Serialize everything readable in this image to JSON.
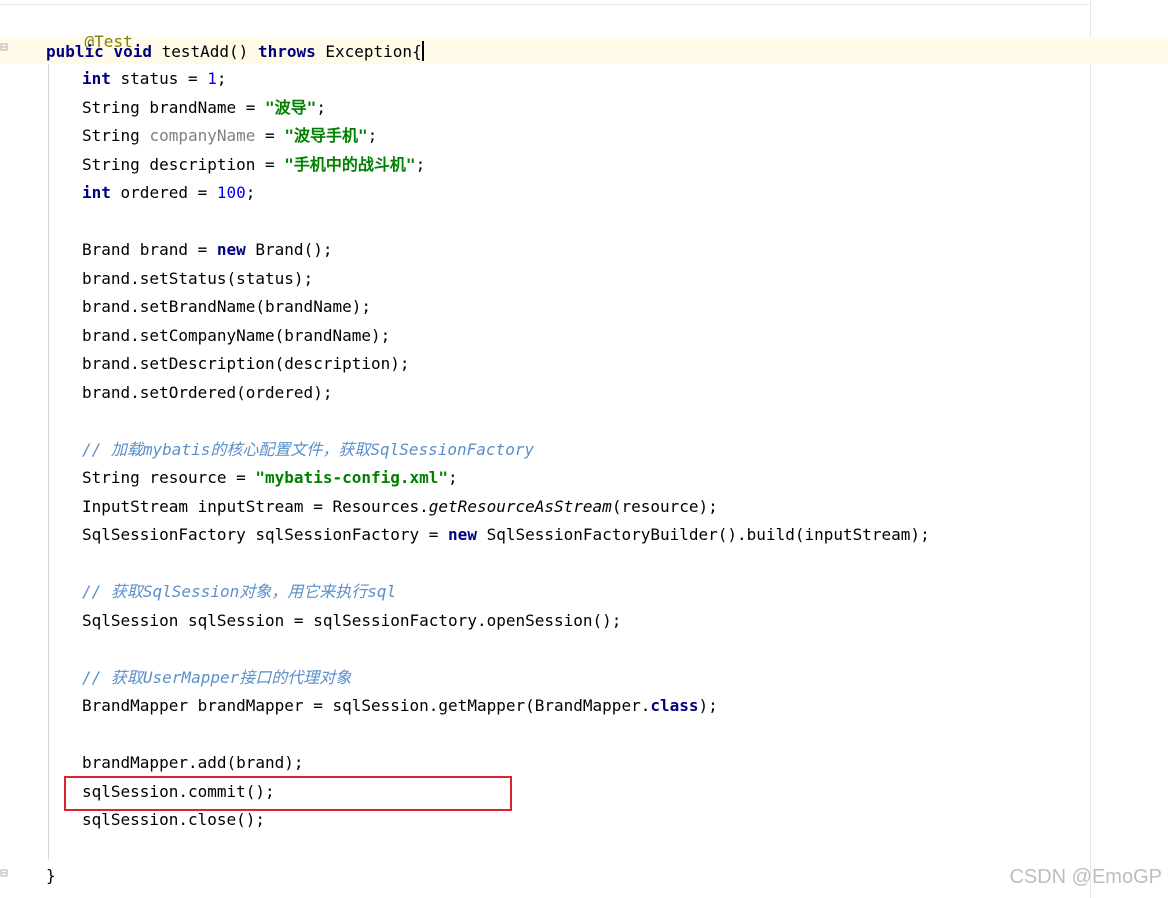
{
  "editor": {
    "lines": {
      "l01": {
        "annotation": "@Test"
      },
      "l02": {
        "kw1": "public",
        "kw2": "void",
        "name": "testAdd() ",
        "kw3": "throws",
        "rest": " Exception{"
      },
      "l03": {
        "kw": "int",
        "a": " status = ",
        "num": "1",
        "b": ";"
      },
      "l04": {
        "a": "String brandName = ",
        "str": "\"波导\"",
        "b": ";"
      },
      "l05": {
        "a": "String ",
        "unused": "companyName",
        "b": " = ",
        "str": "\"波导手机\"",
        "c": ";"
      },
      "l06": {
        "a": "String description = ",
        "str": "\"手机中的战斗机\"",
        "b": ";"
      },
      "l07": {
        "kw": "int",
        "a": " ordered = ",
        "num": "100",
        "b": ";"
      },
      "l08": {
        "a": "Brand brand = ",
        "kw": "new",
        "b": " Brand();"
      },
      "l09": {
        "text": "brand.setStatus(status);"
      },
      "l10": {
        "text": "brand.setBrandName(brandName);"
      },
      "l11": {
        "text": "brand.setCompanyName(brandName);"
      },
      "l12": {
        "text": "brand.setDescription(description);"
      },
      "l13": {
        "text": "brand.setOrdered(ordered);"
      },
      "l14": {
        "comment": "// 加载mybatis的核心配置文件，获取SqlSessionFactory"
      },
      "l15": {
        "a": "String resource = ",
        "str": "\"mybatis-config.xml\"",
        "b": ";"
      },
      "l16": {
        "a": "InputStream inputStream = Resources.",
        "method": "getResourceAsStream",
        "b": "(resource);"
      },
      "l17": {
        "a": "SqlSessionFactory sqlSessionFactory = ",
        "kw": "new",
        "b": " SqlSessionFactoryBuilder().build(inputStream);"
      },
      "l18": {
        "comment": "// 获取SqlSession对象，用它来执行sql"
      },
      "l19": {
        "text": "SqlSession sqlSession = sqlSessionFactory.openSession();"
      },
      "l20": {
        "comment": "// 获取UserMapper接口的代理对象"
      },
      "l21": {
        "a": "BrandMapper brandMapper = sqlSession.getMapper(BrandMapper.",
        "kw": "class",
        "b": ");"
      },
      "l22": {
        "text": "brandMapper.add(brand);"
      },
      "l23": {
        "text": "sqlSession.commit();"
      },
      "l24": {
        "text": "sqlSession.close();"
      },
      "l25": {
        "text": "}"
      }
    },
    "colors": {
      "keyword": "#000080",
      "annotation": "#808000",
      "number": "#0000ff",
      "string": "#008000",
      "comment": "#5a8fcb",
      "highlight_box": "#d9232e"
    }
  },
  "watermark": {
    "text": "CSDN @EmoGP"
  }
}
